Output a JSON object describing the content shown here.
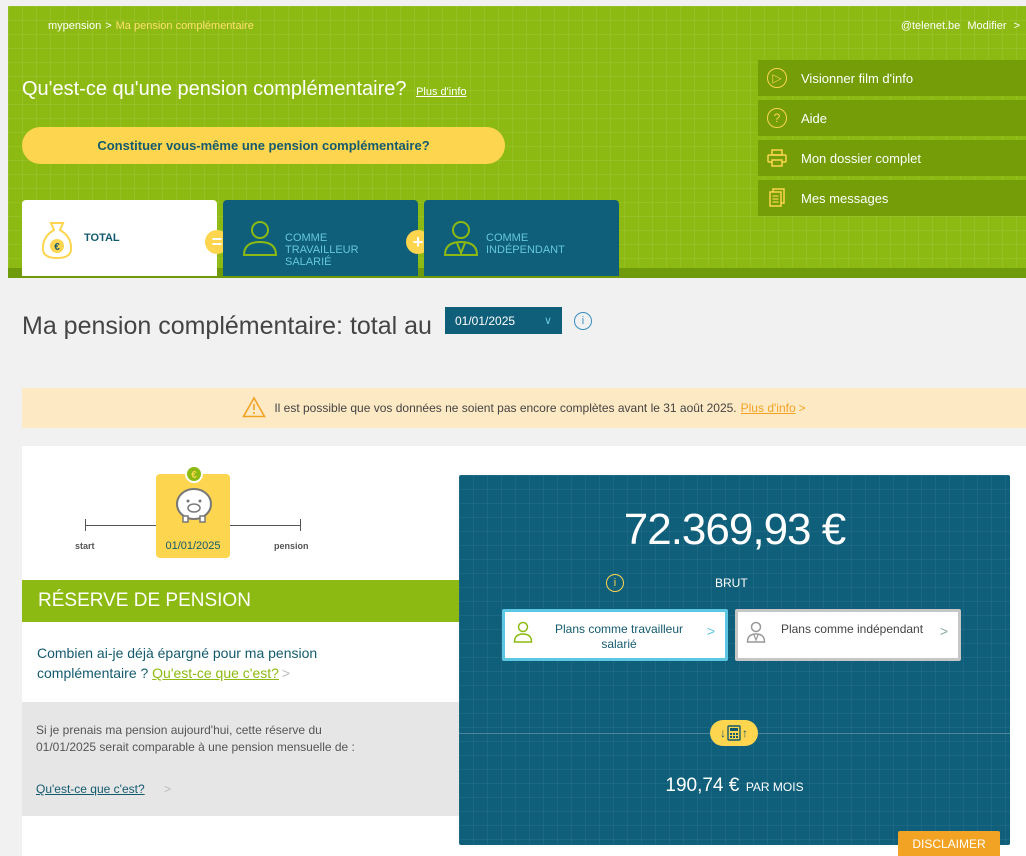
{
  "breadcrumb": {
    "root": "mypension",
    "separator": ">",
    "current": "Ma pension complémentaire"
  },
  "user": {
    "email": "@telenet.be",
    "modify_label": "Modifier",
    "chevron": ">"
  },
  "header": {
    "question": "Qu'est-ce qu'une pension complémentaire?",
    "more_info": "Plus d'info",
    "cta_button": "Constituer vous-même une pension complémentaire?"
  },
  "side_menu": [
    {
      "label": "Visionner film d'info",
      "icon": "play-icon"
    },
    {
      "label": "Aide",
      "icon": "help-icon"
    },
    {
      "label": "Mon dossier complet",
      "icon": "printer-icon"
    },
    {
      "label": "Mes messages",
      "icon": "documents-icon"
    }
  ],
  "tabs": {
    "total": "TOTAL",
    "salarie": [
      "COMME",
      "TRAVAILLEUR",
      "SALARIÉ"
    ],
    "independant": [
      "COMME",
      "INDÉPENDANT"
    ]
  },
  "title": {
    "text": "Ma pension complémentaire: total au",
    "date": "01/01/2025"
  },
  "warning": {
    "text": "Il est possible que vos données ne soient pas encore complètes avant le 31 août 2025.",
    "link": "Plus d'info",
    "chevron": ">"
  },
  "timeline": {
    "start": "start",
    "date": "01/01/2025",
    "end": "pension"
  },
  "reserve": {
    "heading": "RÉSERVE DE PENSION",
    "question": "Combien ai-je déjà épargné pour ma pension complémentaire ?",
    "link": "Qu'est-ce que c'est?",
    "chevron": ">",
    "comparison_text": "Si je prenais ma pension aujourd'hui, cette réserve du 01/01/2025 serait comparable à une pension mensuelle de :",
    "comparison_link": "Qu'est-ce que c'est?"
  },
  "result": {
    "amount": "72.369,93 €",
    "brut": "BRUT",
    "plan_salarie": "Plans comme travailleur salarié",
    "plan_independant": "Plans comme indépendant",
    "plan_chevron": ">",
    "monthly_value": "190,74 €",
    "monthly_unit": "PAR MOIS",
    "disclaimer": "DISCLAIMER"
  },
  "colors": {
    "green": "#8dba12",
    "dark_blue": "#0f5e7a",
    "yellow": "#fdd54f",
    "orange": "#f3a324"
  }
}
